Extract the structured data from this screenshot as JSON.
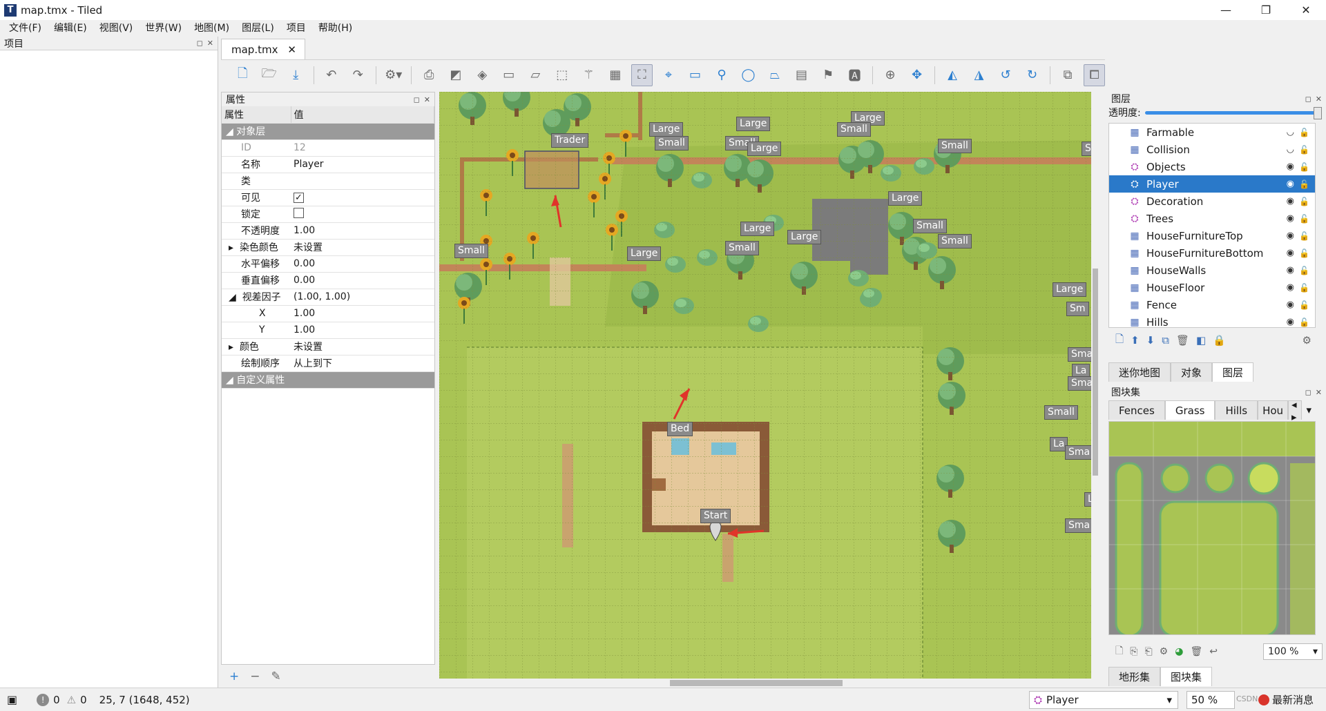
{
  "window": {
    "title": "map.tmx - Tiled",
    "app_icon_glyph": "T",
    "controls": {
      "minimize": "—",
      "maximize": "❐",
      "close": "✕"
    }
  },
  "menu": [
    "文件(F)",
    "编辑(E)",
    "视图(V)",
    "世界(W)",
    "地图(M)",
    "图层(L)",
    "项目",
    "帮助(H)"
  ],
  "project_panel": {
    "title": "项目"
  },
  "document_tab": {
    "label": "map.tmx",
    "close": "✕"
  },
  "properties_panel": {
    "title": "属性",
    "col_property": "属性",
    "col_value": "值",
    "group_object_layer": "对象层",
    "rows": [
      {
        "key": "ID",
        "value": "12"
      },
      {
        "key": "名称",
        "value": "Player"
      },
      {
        "key": "类",
        "value": ""
      },
      {
        "key": "可见",
        "value": "✓"
      },
      {
        "key": "锁定",
        "value": ""
      },
      {
        "key": "不透明度",
        "value": "1.00"
      },
      {
        "key": "染色颜色",
        "value": "未设置"
      },
      {
        "key": "水平偏移",
        "value": "0.00"
      },
      {
        "key": "垂直偏移",
        "value": "0.00"
      },
      {
        "key": "视差因子",
        "value": "(1.00, 1.00)"
      },
      {
        "key": "X",
        "value": "1.00"
      },
      {
        "key": "Y",
        "value": "1.00"
      },
      {
        "key": "颜色",
        "value": "未设置"
      },
      {
        "key": "绘制顺序",
        "value": "从上到下"
      }
    ],
    "group_custom": "自定义属性",
    "footer": {
      "add": "+",
      "remove": "−",
      "edit": "✎"
    }
  },
  "map_labels": {
    "trader": "Trader",
    "bed": "Bed",
    "start": "Start",
    "small": "Small",
    "large": "Large",
    "small_cut": "Sma",
    "small_cut2": "Sm",
    "large_cut": "La",
    "large_cut2": "L",
    "small_cut3": "S"
  },
  "layers_panel": {
    "title": "图层",
    "opacity_label": "透明度:",
    "layers": [
      {
        "name": "Farmable",
        "kind": "tile",
        "visible": false
      },
      {
        "name": "Collision",
        "kind": "tile",
        "visible": false
      },
      {
        "name": "Objects",
        "kind": "object",
        "visible": true
      },
      {
        "name": "Player",
        "kind": "object",
        "visible": true,
        "selected": true
      },
      {
        "name": "Decoration",
        "kind": "object",
        "visible": true
      },
      {
        "name": "Trees",
        "kind": "object",
        "visible": true
      },
      {
        "name": "HouseFurnitureTop",
        "kind": "tile",
        "visible": true
      },
      {
        "name": "HouseFurnitureBottom",
        "kind": "tile",
        "visible": true
      },
      {
        "name": "HouseWalls",
        "kind": "tile",
        "visible": true
      },
      {
        "name": "HouseFloor",
        "kind": "tile",
        "visible": true
      },
      {
        "name": "Fence",
        "kind": "tile",
        "visible": true
      },
      {
        "name": "Hills",
        "kind": "tile",
        "visible": true
      }
    ],
    "tabs": [
      "迷你地图",
      "对象",
      "图层"
    ],
    "active_tab": "图层"
  },
  "tilesets_panel": {
    "title": "图块集",
    "tabs": [
      "Fences",
      "Grass",
      "Hills",
      "Hou"
    ],
    "active_tab": "Grass",
    "zoom": "100 %",
    "bottom_tabs": [
      "地形集",
      "图块集"
    ],
    "active_bottom_tab": "图块集"
  },
  "status_bar": {
    "errors": "0",
    "warnings": "0",
    "coords": "25, 7 (1648, 452)",
    "current_layer": "Player",
    "zoom": "50 %",
    "watermark": "CSDN",
    "news": "最新消息"
  },
  "colors": {
    "selection": "#2a79c9",
    "grass": "#a9c454",
    "label_bg": "#8a8a8a",
    "arrow": "#e0342a"
  }
}
